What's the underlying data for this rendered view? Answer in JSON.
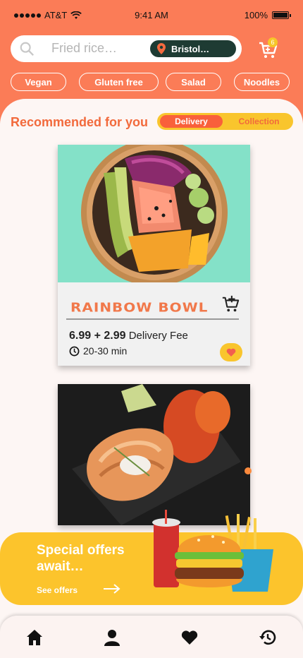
{
  "status": {
    "carrier": "AT&T",
    "time": "9:41 AM",
    "battery": "100%"
  },
  "search": {
    "placeholder": "Fried rice…",
    "location": "Bristol…",
    "cart_count": "6"
  },
  "chips": [
    "Vegan",
    "Gluten free",
    "Salad",
    "Noodles"
  ],
  "section": {
    "title": "Recommended for you",
    "toggle_delivery": "Delivery",
    "toggle_collection": "Collection"
  },
  "card1": {
    "name": "RAINBOW BOWL",
    "price": "6.99 + 2.99",
    "fee": "Delivery Fee",
    "time": "20-30 min"
  },
  "offer": {
    "title": "Special offers await…",
    "link": "See offers"
  },
  "colors": {
    "brand": "#fb7c57",
    "accent": "#fcc42c",
    "dark": "#1e3b33"
  },
  "tabs": [
    "home-icon",
    "profile-icon",
    "heart-icon",
    "history-icon"
  ]
}
